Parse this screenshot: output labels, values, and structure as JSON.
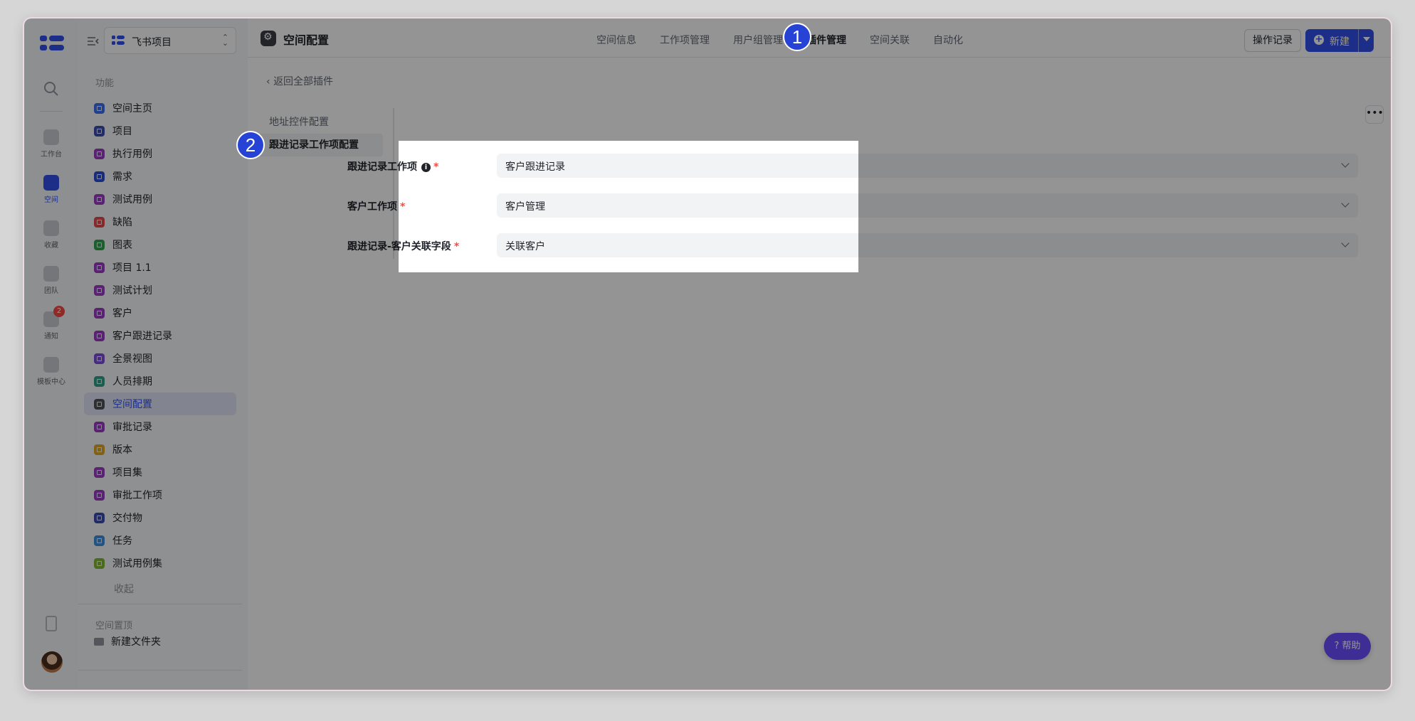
{
  "rail": {
    "items": [
      {
        "label": "工作台",
        "icon": "home-icon"
      },
      {
        "label": "空间",
        "icon": "space-icon",
        "active": true
      },
      {
        "label": "收藏",
        "icon": "star-icon"
      },
      {
        "label": "团队",
        "icon": "team-icon"
      },
      {
        "label": "通知",
        "icon": "bell-icon",
        "badge": "2"
      },
      {
        "label": "模板中心",
        "icon": "template-icon"
      }
    ]
  },
  "sidebar": {
    "project_name": "飞书项目",
    "section_label": "功能",
    "items": [
      {
        "label": "空间主页",
        "color": "#3b6ff0"
      },
      {
        "label": "项目",
        "color": "#3b4fb4"
      },
      {
        "label": "执行用例",
        "color": "#9b3bc4"
      },
      {
        "label": "需求",
        "color": "#2d4fd6"
      },
      {
        "label": "测试用例",
        "color": "#9b3bc4"
      },
      {
        "label": "缺陷",
        "color": "#e5484d"
      },
      {
        "label": "图表",
        "color": "#2ea44f"
      },
      {
        "label": "项目 1.1",
        "color": "#9b3bc4"
      },
      {
        "label": "测试计划",
        "color": "#9b3bc4"
      },
      {
        "label": "客户",
        "color": "#9b3bc4"
      },
      {
        "label": "客户跟进记录",
        "color": "#9b3bc4"
      },
      {
        "label": "全景视图",
        "color": "#7b4de0"
      },
      {
        "label": "人员排期",
        "color": "#2ea38a"
      },
      {
        "label": "空间配置",
        "color": "#4e5259",
        "active": true
      },
      {
        "label": "审批记录",
        "color": "#9b3bc4"
      },
      {
        "label": "版本",
        "color": "#e0a826"
      },
      {
        "label": "项目集",
        "color": "#9b3bc4"
      },
      {
        "label": "审批工作项",
        "color": "#9b3bc4"
      },
      {
        "label": "交付物",
        "color": "#3b4fb4"
      },
      {
        "label": "任务",
        "color": "#3b8fe0"
      },
      {
        "label": "测试用例集",
        "color": "#7fb82e"
      }
    ],
    "collapse_label": "收起",
    "pinned_label": "空间置顶",
    "folder_label": "新建文件夹"
  },
  "topbar": {
    "title": "空间配置",
    "tabs": [
      {
        "label": "空间信息"
      },
      {
        "label": "工作项管理"
      },
      {
        "label": "用户组管理"
      },
      {
        "label": "插件管理",
        "active": true
      },
      {
        "label": "空间关联"
      },
      {
        "label": "自动化"
      }
    ],
    "log_button": "操作记录",
    "new_button": "新建"
  },
  "content": {
    "back_label": "返回全部插件",
    "sub_nav": [
      {
        "label": "地址控件配置"
      },
      {
        "label": "跟进记录工作项配置",
        "active": true
      }
    ],
    "fields": [
      {
        "label": "跟进记录工作项",
        "value": "客户跟进记录",
        "info": true
      },
      {
        "label": "客户工作项",
        "value": "客户管理"
      },
      {
        "label": "跟进记录-客户关联字段",
        "value": "关联客户"
      }
    ],
    "required_mark": "*",
    "info_glyph": "i"
  },
  "help_button": "帮助",
  "markers": [
    "1",
    "2"
  ],
  "colors": {
    "accent": "#3250eb",
    "required": "#f54a45",
    "marker": "#2743d6"
  }
}
